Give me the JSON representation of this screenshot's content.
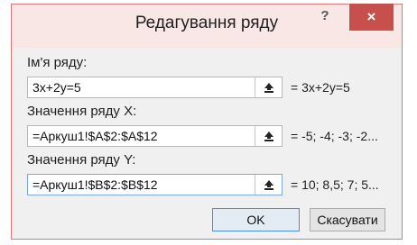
{
  "dialog": {
    "title": "Редагування ряду",
    "help_label": "?",
    "close_label": "×"
  },
  "fields": [
    {
      "label": "Ім'я ряду:",
      "value": "3x+2y=5",
      "preview": "= 3x+2y=5"
    },
    {
      "label": "Значення ряду X:",
      "value": "=Аркуш1!$A$2:$A$12",
      "preview": "= -5; -4; -3; -2..."
    },
    {
      "label": "Значення ряду Y:",
      "value": "=Аркуш1!$B$2:$B$12",
      "preview": "= 10; 8,5; 7; 5..."
    }
  ],
  "buttons": {
    "ok": "OK",
    "cancel": "Скасувати"
  },
  "icons": {
    "collapse": "collapse-dialog-icon",
    "help": "help-icon",
    "close": "close-icon"
  },
  "colors": {
    "titlebar": "#f8e7e5",
    "close_button": "#c7504d",
    "border": "#d97a7a"
  }
}
